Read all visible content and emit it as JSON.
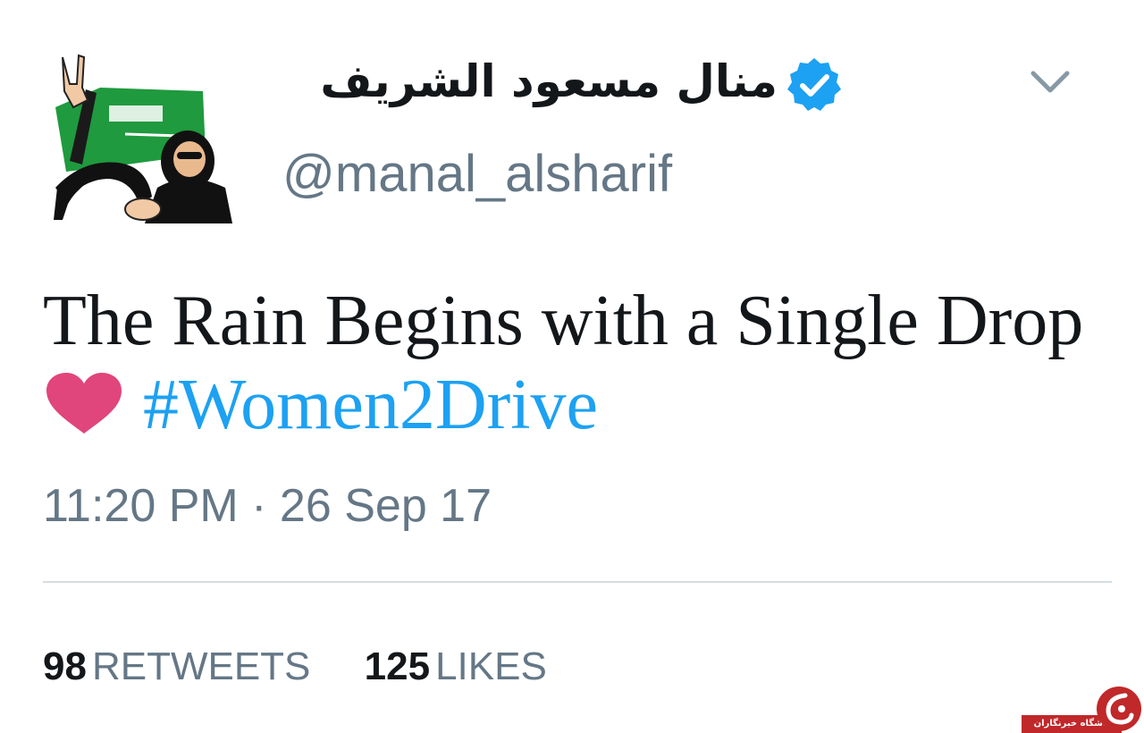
{
  "tweet": {
    "display_name": "منال مسعود الشريف",
    "handle": "@manal_alsharif",
    "text": "The Rain Begins with a Single Drop",
    "emoji": "heart-emoji",
    "hashtag": "#Women2Drive",
    "timestamp": "11:20 PM · 26 Sep 17",
    "retweets_count": "98",
    "retweets_label": "RETWEETS",
    "likes_count": "125",
    "likes_label": "LIKES"
  },
  "icons": {
    "verified": "verified-badge-icon",
    "menu": "chevron-down-icon",
    "avatar": "avatar"
  },
  "watermark": {
    "text": "باشگاه خبرنگاران"
  },
  "colors": {
    "text": "#14171a",
    "secondary": "#657786",
    "hashtag": "#1da1f2",
    "verified": "#1da1f2",
    "heart": "#e0457b",
    "divider": "#d4dde3",
    "watermark": "#c0282a"
  }
}
